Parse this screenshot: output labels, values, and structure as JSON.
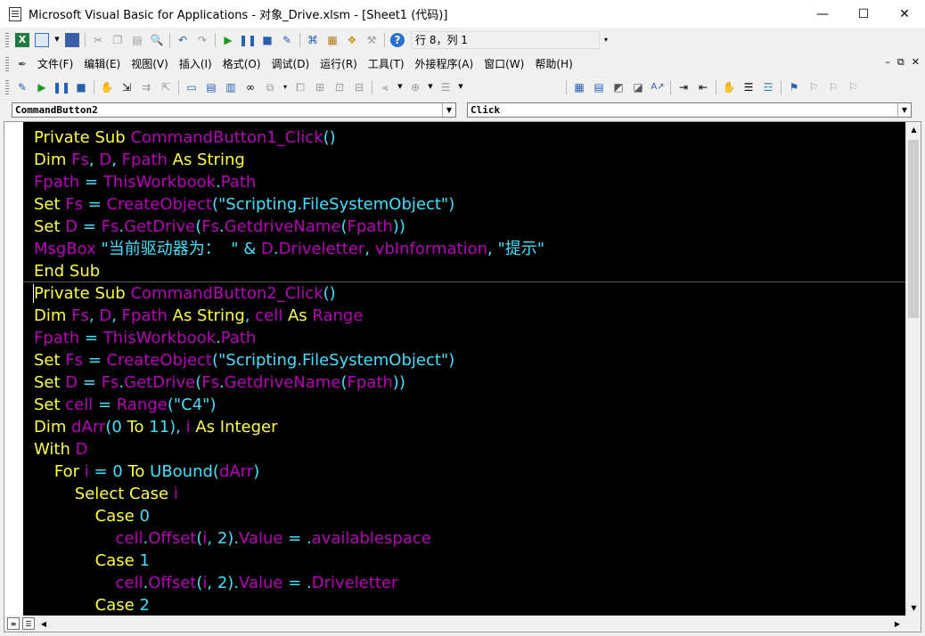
{
  "window": {
    "title": "Microsoft Visual Basic for Applications - 对象_Drive.xlsm - [Sheet1 (代码)]",
    "minimize": "—",
    "maximize": "☐",
    "close": "✕"
  },
  "standard_toolbar": {
    "status_text": "行 8，列 1"
  },
  "menu": {
    "items": [
      "文件(F)",
      "编辑(E)",
      "视图(V)",
      "插入(I)",
      "格式(O)",
      "调试(D)",
      "运行(R)",
      "工具(T)",
      "外接程序(A)",
      "窗口(W)",
      "帮助(H)"
    ],
    "mdi_minimize": "–",
    "mdi_restore": "⧉",
    "mdi_close": "✕"
  },
  "object_combo": {
    "value": "CommandButton2"
  },
  "procedure_combo": {
    "value": "Click"
  },
  "colors": {
    "keyword": "#ffff40",
    "identifier": "#b800b8",
    "operator_literal": "#40e0ff",
    "background": "#000000"
  },
  "code_lines": [
    [
      [
        "kw",
        "Private Sub "
      ],
      [
        "id",
        "CommandButton1_Click"
      ],
      [
        "op",
        "()"
      ]
    ],
    [
      [
        "kw",
        "Dim "
      ],
      [
        "id",
        "Fs"
      ],
      [
        "op",
        ", "
      ],
      [
        "id",
        "D"
      ],
      [
        "op",
        ", "
      ],
      [
        "id",
        "Fpath"
      ],
      [
        "kw",
        " As String"
      ]
    ],
    [
      [
        "id",
        "Fpath"
      ],
      [
        "op",
        " = "
      ],
      [
        "id",
        "ThisWorkbook"
      ],
      [
        "op",
        "."
      ],
      [
        "id",
        "Path"
      ]
    ],
    [
      [
        "kw",
        "Set "
      ],
      [
        "id",
        "Fs"
      ],
      [
        "op",
        " = "
      ],
      [
        "id",
        "CreateObject"
      ],
      [
        "op",
        "(\"Scripting.FileSystemObject\")"
      ]
    ],
    [
      [
        "kw",
        "Set "
      ],
      [
        "id",
        "D"
      ],
      [
        "op",
        " = "
      ],
      [
        "id",
        "Fs"
      ],
      [
        "op",
        "."
      ],
      [
        "id",
        "GetDrive"
      ],
      [
        "op",
        "("
      ],
      [
        "id",
        "Fs"
      ],
      [
        "op",
        "."
      ],
      [
        "id",
        "GetdriveName"
      ],
      [
        "op",
        "("
      ],
      [
        "id",
        "Fpath"
      ],
      [
        "op",
        "))"
      ]
    ],
    [
      [
        "id",
        "MsgBox"
      ],
      [
        "op",
        " \"当前驱动器为：  \" & "
      ],
      [
        "id",
        "D"
      ],
      [
        "op",
        "."
      ],
      [
        "id",
        "Driveletter"
      ],
      [
        "op",
        ", "
      ],
      [
        "id",
        "vbInformation"
      ],
      [
        "op",
        ", \"提示\""
      ]
    ],
    [
      [
        "kw",
        "End Sub"
      ]
    ],
    [
      [
        "kw",
        "Private Sub "
      ],
      [
        "id",
        "CommandButton2_Click"
      ],
      [
        "op",
        "()"
      ]
    ],
    [
      [
        "kw",
        "Dim "
      ],
      [
        "id",
        "Fs"
      ],
      [
        "op",
        ", "
      ],
      [
        "id",
        "D"
      ],
      [
        "op",
        ", "
      ],
      [
        "id",
        "Fpath"
      ],
      [
        "kw",
        " As String"
      ],
      [
        "op",
        ", "
      ],
      [
        "id",
        "cell"
      ],
      [
        "kw",
        " As "
      ],
      [
        "id",
        "Range"
      ]
    ],
    [
      [
        "id",
        "Fpath"
      ],
      [
        "op",
        " = "
      ],
      [
        "id",
        "ThisWorkbook"
      ],
      [
        "op",
        "."
      ],
      [
        "id",
        "Path"
      ]
    ],
    [
      [
        "kw",
        "Set "
      ],
      [
        "id",
        "Fs"
      ],
      [
        "op",
        " = "
      ],
      [
        "id",
        "CreateObject"
      ],
      [
        "op",
        "(\"Scripting.FileSystemObject\")"
      ]
    ],
    [
      [
        "kw",
        "Set "
      ],
      [
        "id",
        "D"
      ],
      [
        "op",
        " = "
      ],
      [
        "id",
        "Fs"
      ],
      [
        "op",
        "."
      ],
      [
        "id",
        "GetDrive"
      ],
      [
        "op",
        "("
      ],
      [
        "id",
        "Fs"
      ],
      [
        "op",
        "."
      ],
      [
        "id",
        "GetdriveName"
      ],
      [
        "op",
        "("
      ],
      [
        "id",
        "Fpath"
      ],
      [
        "op",
        "))"
      ]
    ],
    [
      [
        "kw",
        "Set "
      ],
      [
        "id",
        "cell"
      ],
      [
        "op",
        " = "
      ],
      [
        "id",
        "Range"
      ],
      [
        "op",
        "(\"C4\")"
      ]
    ],
    [
      [
        "kw",
        "Dim "
      ],
      [
        "id",
        "dArr"
      ],
      [
        "op",
        "(0 "
      ],
      [
        "kw",
        "To"
      ],
      [
        "op",
        " 11), "
      ],
      [
        "id",
        "i"
      ],
      [
        "kw",
        " As Integer"
      ]
    ],
    [
      [
        "kw",
        "With "
      ],
      [
        "id",
        "D"
      ]
    ],
    [
      [
        "op",
        "    "
      ],
      [
        "kw",
        "For "
      ],
      [
        "id",
        "i"
      ],
      [
        "op",
        " = 0 "
      ],
      [
        "kw",
        "To "
      ],
      [
        "op",
        "UBound("
      ],
      [
        "id",
        "dArr"
      ],
      [
        "op",
        ")"
      ]
    ],
    [
      [
        "op",
        "        "
      ],
      [
        "kw",
        "Select Case "
      ],
      [
        "id",
        "i"
      ]
    ],
    [
      [
        "op",
        "            "
      ],
      [
        "kw",
        "Case "
      ],
      [
        "op",
        "0"
      ]
    ],
    [
      [
        "op",
        "                "
      ],
      [
        "id",
        "cell"
      ],
      [
        "op",
        "."
      ],
      [
        "id",
        "Offset"
      ],
      [
        "op",
        "("
      ],
      [
        "id",
        "i"
      ],
      [
        "op",
        ", 2)."
      ],
      [
        "id",
        "Value"
      ],
      [
        "op",
        " = ."
      ],
      [
        "id",
        "availablespace"
      ]
    ],
    [
      [
        "op",
        "            "
      ],
      [
        "kw",
        "Case "
      ],
      [
        "op",
        "1"
      ]
    ],
    [
      [
        "op",
        "                "
      ],
      [
        "id",
        "cell"
      ],
      [
        "op",
        "."
      ],
      [
        "id",
        "Offset"
      ],
      [
        "op",
        "("
      ],
      [
        "id",
        "i"
      ],
      [
        "op",
        ", 2)."
      ],
      [
        "id",
        "Value"
      ],
      [
        "op",
        " = ."
      ],
      [
        "id",
        "Driveletter"
      ]
    ],
    [
      [
        "op",
        "            "
      ],
      [
        "kw",
        "Case "
      ],
      [
        "op",
        "2"
      ]
    ]
  ]
}
